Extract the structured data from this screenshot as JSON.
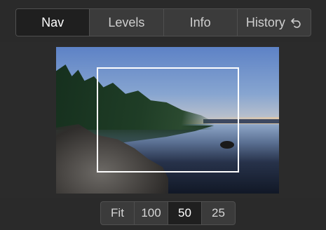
{
  "tabs": [
    {
      "label": "Nav",
      "active": true
    },
    {
      "label": "Levels",
      "active": false
    },
    {
      "label": "Info",
      "active": false
    },
    {
      "label": "History",
      "active": false,
      "icon": "undo-icon"
    }
  ],
  "zoom": {
    "options": [
      "Fit",
      "100",
      "50",
      "25"
    ],
    "selected": "50"
  },
  "colors": {
    "background": "#2b2b2b",
    "active_tab": "#1f1f1f",
    "viewport_border": "#ffffff"
  }
}
